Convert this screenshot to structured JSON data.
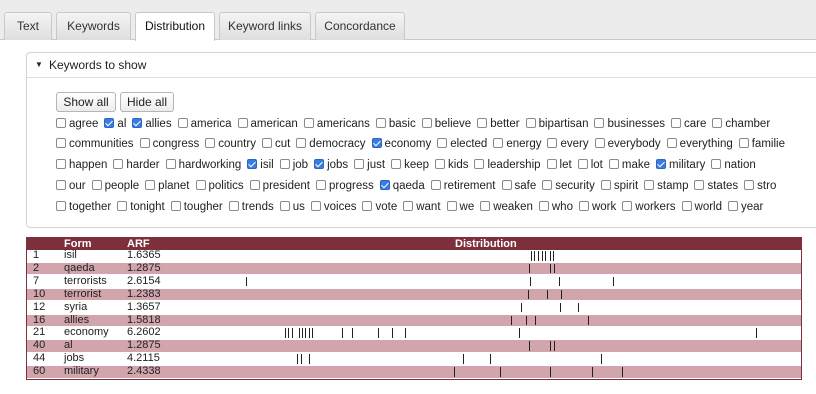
{
  "tabs": [
    "Text",
    "Keywords",
    "Distribution",
    "Keyword links",
    "Concordance"
  ],
  "active_tab": "Distribution",
  "keywords_panel": {
    "title": "Keywords to show",
    "show_all": "Show all",
    "hide_all": "Hide all",
    "rows": [
      [
        [
          "agree",
          false
        ],
        [
          "al",
          true
        ],
        [
          "allies",
          true
        ],
        [
          "america",
          false
        ],
        [
          "american",
          false
        ],
        [
          "americans",
          false
        ],
        [
          "basic",
          false
        ],
        [
          "believe",
          false
        ],
        [
          "better",
          false
        ],
        [
          "bipartisan",
          false
        ],
        [
          "businesses",
          false
        ],
        [
          "care",
          false
        ],
        [
          "chamber",
          false
        ]
      ],
      [
        [
          "communities",
          false
        ],
        [
          "congress",
          false
        ],
        [
          "country",
          false
        ],
        [
          "cut",
          false
        ],
        [
          "democracy",
          false
        ],
        [
          "economy",
          true
        ],
        [
          "elected",
          false
        ],
        [
          "energy",
          false
        ],
        [
          "every",
          false
        ],
        [
          "everybody",
          false
        ],
        [
          "everything",
          false
        ],
        [
          "familie",
          false
        ]
      ],
      [
        [
          "happen",
          false
        ],
        [
          "harder",
          false
        ],
        [
          "hardworking",
          false
        ],
        [
          "isil",
          true
        ],
        [
          "job",
          false
        ],
        [
          "jobs",
          true
        ],
        [
          "just",
          false
        ],
        [
          "keep",
          false
        ],
        [
          "kids",
          false
        ],
        [
          "leadership",
          false
        ],
        [
          "let",
          false
        ],
        [
          "lot",
          false
        ],
        [
          "make",
          false
        ],
        [
          "military",
          true
        ],
        [
          "nation",
          false
        ]
      ],
      [
        [
          "our",
          false
        ],
        [
          "people",
          false
        ],
        [
          "planet",
          false
        ],
        [
          "politics",
          false
        ],
        [
          "president",
          false
        ],
        [
          "progress",
          false
        ],
        [
          "qaeda",
          true
        ],
        [
          "retirement",
          false
        ],
        [
          "safe",
          false
        ],
        [
          "security",
          false
        ],
        [
          "spirit",
          false
        ],
        [
          "stamp",
          false
        ],
        [
          "states",
          false
        ],
        [
          "stro",
          false
        ]
      ],
      [
        [
          "together",
          false
        ],
        [
          "tonight",
          false
        ],
        [
          "tougher",
          false
        ],
        [
          "trends",
          false
        ],
        [
          "us",
          false
        ],
        [
          "voices",
          false
        ],
        [
          "vote",
          false
        ],
        [
          "want",
          false
        ],
        [
          "we",
          false
        ],
        [
          "weaken",
          false
        ],
        [
          "who",
          false
        ],
        [
          "work",
          false
        ],
        [
          "workers",
          false
        ],
        [
          "world",
          false
        ],
        [
          "year",
          false
        ]
      ]
    ]
  },
  "distribution": {
    "headers": {
      "form": "Form",
      "arf": "ARF",
      "dist": "Distribution"
    },
    "rows": [
      {
        "n": "1",
        "form": "isil",
        "arf": "1.6365",
        "ticks": [
          0.548,
          0.554,
          0.56,
          0.566,
          0.572,
          0.58,
          0.585
        ]
      },
      {
        "n": "2",
        "form": "qaeda",
        "arf": "1.2875",
        "ticks": [
          0.545,
          0.58,
          0.586
        ]
      },
      {
        "n": "7",
        "form": "terrorists",
        "arf": "2.6154",
        "ticks": [
          0.073,
          0.547,
          0.595,
          0.685
        ]
      },
      {
        "n": "10",
        "form": "terrorist",
        "arf": "1.2383",
        "ticks": [
          0.544,
          0.575,
          0.599
        ]
      },
      {
        "n": "12",
        "form": "syria",
        "arf": "1.3657",
        "ticks": [
          0.532,
          0.597,
          0.627
        ]
      },
      {
        "n": "16",
        "form": "allies",
        "arf": "1.5818",
        "ticks": [
          0.515,
          0.54,
          0.555,
          0.644
        ]
      },
      {
        "n": "21",
        "form": "economy",
        "arf": "6.2602",
        "ticks": [
          0.138,
          0.144,
          0.15,
          0.162,
          0.167,
          0.172,
          0.178,
          0.183,
          0.233,
          0.25,
          0.294,
          0.317,
          0.339,
          0.529,
          0.923
        ]
      },
      {
        "n": "40",
        "form": "al",
        "arf": "1.2875",
        "ticks": [
          0.545,
          0.58,
          0.586
        ]
      },
      {
        "n": "44",
        "form": "jobs",
        "arf": "4.2115",
        "ticks": [
          0.158,
          0.165,
          0.179,
          0.435,
          0.48,
          0.665
        ]
      },
      {
        "n": "60",
        "form": "military",
        "arf": "2.4338",
        "ticks": [
          0.42,
          0.497,
          0.58,
          0.65,
          0.7
        ]
      }
    ]
  }
}
